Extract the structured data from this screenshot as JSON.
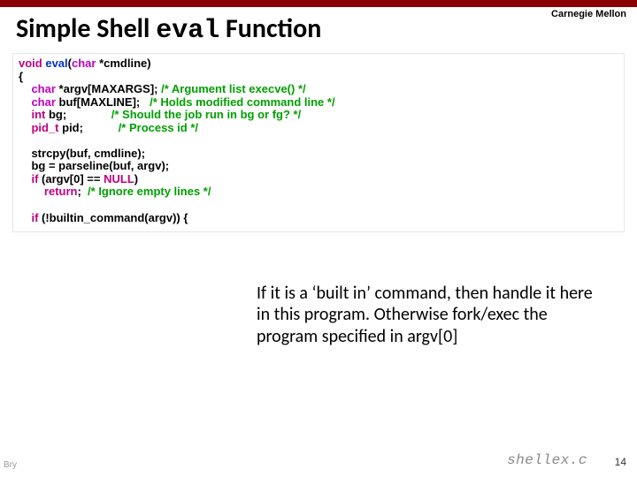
{
  "brand": "Carnegie Mellon",
  "title_pre": "Simple Shell ",
  "title_code": "eval",
  "title_post": " Function",
  "code": {
    "l1_void": "void",
    "l1_fn": " eval",
    "l1_rest": "(",
    "l1_char": "char",
    "l1_tail": " *cmdline)",
    "l2": "{",
    "l3_indent": "    ",
    "l3_char": "char",
    "l3_rest": " *argv[MAXARGS]; ",
    "l3_cmt": "/* Argument list execve() */",
    "l4_indent": "    ",
    "l4_char": "char",
    "l4_rest": " buf[MAXLINE];   ",
    "l4_cmt": "/* Holds modified command line */",
    "l5_indent": "    ",
    "l5_int": "int",
    "l5_rest": " bg;              ",
    "l5_cmt": "/* Should the job run in bg or fg? */",
    "l6_indent": "    ",
    "l6_pid": "pid_t",
    "l6_rest": " pid;           ",
    "l6_cmt": "/* Process id */",
    "l8_indent": "    ",
    "l8": "strcpy(buf, cmdline);",
    "l9_indent": "    ",
    "l9": "bg = parseline(buf, argv);",
    "l10_indent": "    ",
    "l10_if": "if",
    "l10_rest": " (argv[0] == ",
    "l10_null": "NULL",
    "l10_tail": ")",
    "l11_indent": "        ",
    "l11_ret": "return",
    "l11_rest": ";  ",
    "l11_cmt": "/* Ignore empty lines */",
    "l13_indent": "    ",
    "l13_if": "if",
    "l13_rest": " (!builtin_command(argv)) {"
  },
  "callout": "If it is a ‘built in’ command, then handle it here in this program. Otherwise fork/exec the program specified in argv[0]",
  "source": "shellex.c",
  "pagenum": "14",
  "credit": "Bry"
}
